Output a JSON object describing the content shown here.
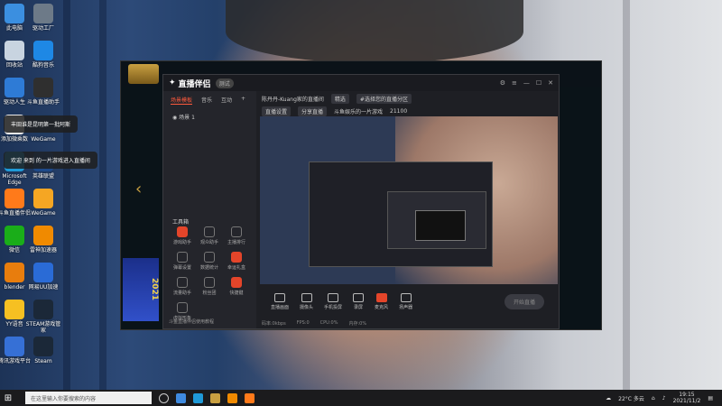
{
  "desktop_icons": [
    {
      "label": "此电脑",
      "color": "#3b8fe0"
    },
    {
      "label": "回收站",
      "color": "#c8d4e0"
    },
    {
      "label": "驱动人生",
      "color": "#2e7bd6"
    },
    {
      "label": "添加微乘数",
      "color": "#e8e8e8"
    },
    {
      "label": "Microsoft Edge",
      "color": "#1f9ad8"
    },
    {
      "label": "斗鱼直播伴侣",
      "color": "#ff7a1a"
    },
    {
      "label": "微信",
      "color": "#1aad19"
    },
    {
      "label": "blender",
      "color": "#e87d0d"
    },
    {
      "label": "YY语音",
      "color": "#f6c022"
    },
    {
      "label": "腾讯游戏平台",
      "color": "#3670d6"
    }
  ],
  "desktop_icons_col2": [
    {
      "label": "驱动工厂",
      "color": "#6d7a88"
    },
    {
      "label": "酷狗音乐",
      "color": "#1e88e5"
    },
    {
      "label": "斗鱼直播助手",
      "color": "#2f2f2f"
    },
    {
      "label": "WeGame",
      "color": "#1f3a5f"
    },
    {
      "label": "英雄联盟",
      "color": "#1e4a8a"
    },
    {
      "label": "WeGame",
      "color": "#f5a623"
    },
    {
      "label": "雷神加速器",
      "color": "#f08a00"
    },
    {
      "label": "网易UU加速",
      "color": "#2a6bd6"
    },
    {
      "label": "STEAM游戏管家",
      "color": "#1b2838"
    },
    {
      "label": "Steam",
      "color": "#1b2838"
    }
  ],
  "toasts": [
    "丰田谁是昆明第一批阿斯",
    "欢迎 来到 的一片游戏进入直播间"
  ],
  "main_window": {
    "title": "直播伴侣",
    "version": "测试",
    "sidebar_tabs": [
      "场景模板",
      "音乐",
      "互动"
    ],
    "scene_label": "场景 1",
    "toolbox_title": "工具箱",
    "tools": [
      "游戏助手",
      "观众助手",
      "主播排行",
      "弹幕设置",
      "数据统计",
      "幸运礼盒",
      "流量助手",
      "粉丝团",
      "快捷键",
      "虚拟形象"
    ],
    "sidebar_footer": "斗鱼直播伴侣使用教程",
    "info_row1": [
      "陈丹丹-Kuang家的直播间",
      "精选",
      "#选择您的直播分区"
    ],
    "info_row2": [
      "直播设置",
      "分享直播",
      "斗鱼娱乐的一片游戏",
      "21100"
    ],
    "bottom_buttons": [
      "直播画面",
      "摄像头",
      "手机投屏",
      "录屏",
      "麦克风",
      "扬声器"
    ],
    "start_live": "开始直播",
    "status_items": [
      "码率:0kbps",
      "FPS:0",
      "CPU:0%",
      "内存:0%"
    ]
  },
  "taskbar": {
    "search_placeholder": "在这里输入你要搜索的内容",
    "weather": "22°C 多云",
    "time": "19:15",
    "date": "2021/11/2"
  }
}
